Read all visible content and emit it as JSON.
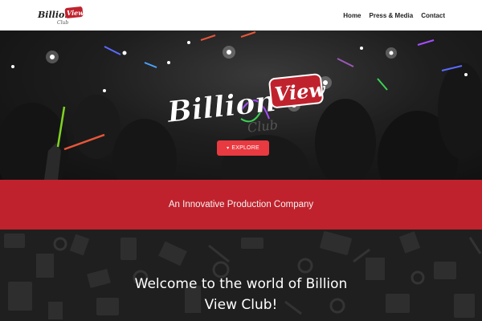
{
  "brand": {
    "logo_word1": "Billion",
    "logo_word2": "View",
    "logo_word3": "Club"
  },
  "nav": {
    "items": [
      {
        "label": "Home"
      },
      {
        "label": "Press & Media"
      },
      {
        "label": "Contact"
      }
    ]
  },
  "hero": {
    "button_label": "EXPLORE",
    "button_icon": "caret-down-icon"
  },
  "tagline": "An Innovative Production Company",
  "welcome": {
    "heading": "Welcome to the world of Billion View Club!"
  },
  "colors": {
    "accent": "#c0222d",
    "button": "#e83a40",
    "nav_bg": "#ffffff",
    "dark_bg": "#1f1f1f"
  }
}
